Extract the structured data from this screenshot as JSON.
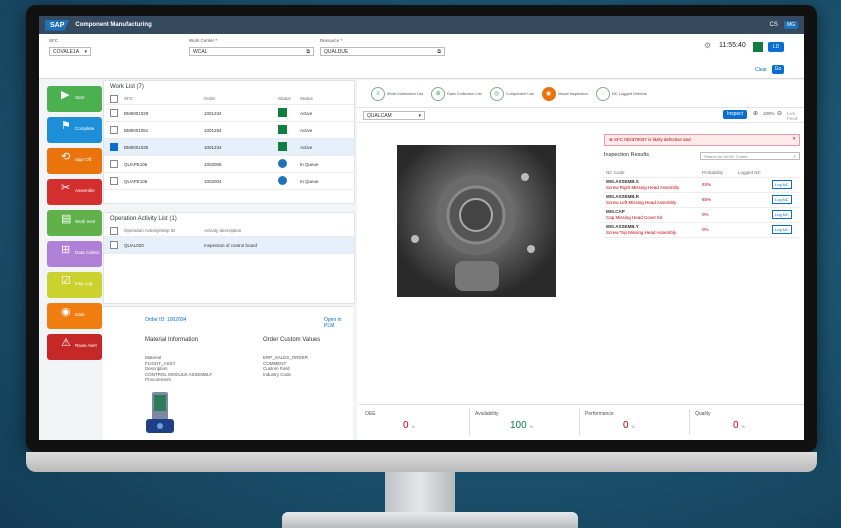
{
  "shell": {
    "logo": "SAP",
    "title": "Component Manufacturing",
    "user_initials": "CS",
    "avatar": "MG"
  },
  "filters": {
    "sfc_label": "SFC",
    "sfc_value": "COVALE1A",
    "work_center_label": "Work Center *",
    "work_center_value": "WCAL",
    "resource_label": "Resource *",
    "resource_value": "QUALDUE",
    "clock": "11:55:40",
    "user_btn": "LD",
    "clear_label": "Clear",
    "go_label": "Go"
  },
  "actions": [
    {
      "label": "Start",
      "icon": "▶",
      "color": "#4caf50"
    },
    {
      "label": "Complete",
      "icon": "⚑",
      "color": "#1d8fd8"
    },
    {
      "label": "Sign Off",
      "icon": "⟲",
      "color": "#e9730c"
    },
    {
      "label": "Assemble",
      "icon": "✂",
      "color": "#d32f2f"
    },
    {
      "label": "Work Instr",
      "icon": "▤",
      "color": "#60b14a"
    },
    {
      "label": "Data Collect",
      "icon": "⊞",
      "color": "#b07fd6"
    },
    {
      "label": "Insp Log",
      "icon": "☑",
      "color": "#cbd230"
    },
    {
      "label": "Data",
      "icon": "◉",
      "color": "#ef7d10"
    },
    {
      "label": "Raise Alert",
      "icon": "⚠",
      "color": "#c62828"
    }
  ],
  "worklist": {
    "title": "Work List (7)",
    "columns": [
      "SFC",
      "Order",
      "Status",
      "Status"
    ],
    "rows": [
      {
        "sfc": "BM0001029",
        "order": "1001234",
        "status": "Active",
        "kind": "green",
        "selected": false,
        "checked": false
      },
      {
        "sfc": "BM0001051",
        "order": "1001254",
        "status": "Active",
        "kind": "green",
        "selected": false,
        "checked": false
      },
      {
        "sfc": "BM0001030",
        "order": "1001234",
        "status": "Active",
        "kind": "green",
        "selected": true,
        "checked": true
      },
      {
        "sfc": "QUAPE106",
        "order": "1002005",
        "status": "In Queue",
        "kind": "blue",
        "selected": false,
        "checked": false
      },
      {
        "sfc": "QUAPE106",
        "order": "1002004",
        "status": "In Queue",
        "kind": "blue",
        "selected": false,
        "checked": false
      }
    ]
  },
  "operations": {
    "title": "Operation Activity List (1)",
    "columns": [
      "Operation Activity/Step ID",
      "Activity description"
    ],
    "rows": [
      {
        "id": "QUAL020",
        "desc": "Inspection of control board"
      }
    ]
  },
  "order": {
    "title": "Order ID: 1002094",
    "link": "Open in PLM",
    "material_header": "Material Information",
    "custom_header": "Order Custom Values",
    "material_text": "Material\nFLIGHT_ASSY\nDescription\nCONTROL MODULE ASSEMBLY\nProcurement",
    "custom_text": "ERP_SALES_ORDER\nCOMMENT\nCustom Field\nIndustry Code"
  },
  "activities": [
    {
      "label": "Work Instruction List",
      "icon": "≡"
    },
    {
      "label": "Data Collection List",
      "icon": "⊕"
    },
    {
      "label": "Component List",
      "icon": "◎"
    },
    {
      "label": "Visual Inspection",
      "icon": "◉",
      "active": true
    },
    {
      "label": "NC Logged Defects",
      "icon": "◌"
    }
  ],
  "viewer": {
    "dropdown": "QUALCAM",
    "inspect_btn": "Inspect",
    "zoom": "100%",
    "mode": "Live Feed"
  },
  "inspection": {
    "error": "SFC 002370037 is likely defective and ",
    "title": "Inspection Results",
    "search_placeholder": "Search for All NC Codes",
    "columns": [
      "NC Code",
      "Probability",
      "Logged NC"
    ],
    "rows": [
      {
        "code": "MIS.ASSEMB.S",
        "desc": "Screw Right Missing Head Assembly",
        "prob": "93%",
        "btn": "Log NC"
      },
      {
        "code": "MIS.ASSEMB.R",
        "desc": "Screw Left Missing Head Assembly",
        "prob": "88%",
        "btn": "Log NC"
      },
      {
        "code": "MIS.CAP",
        "desc": "Cap Missing Head Cover Kit",
        "prob": "0%",
        "btn": "Log NC"
      },
      {
        "code": "MIS.ASSEMB.Y",
        "desc": "Screw Top Missing Head Assembly",
        "prob": "0%",
        "btn": "Log NC"
      }
    ]
  },
  "kpis": [
    {
      "label": "OEE",
      "value": "0",
      "color": "#c00"
    },
    {
      "label": "Availability",
      "value": "100",
      "color": "#107e3e"
    },
    {
      "label": "Performance",
      "value": "0",
      "color": "#c00"
    },
    {
      "label": "Quality",
      "value": "0",
      "color": "#c00"
    }
  ],
  "kpi_unit": "%"
}
